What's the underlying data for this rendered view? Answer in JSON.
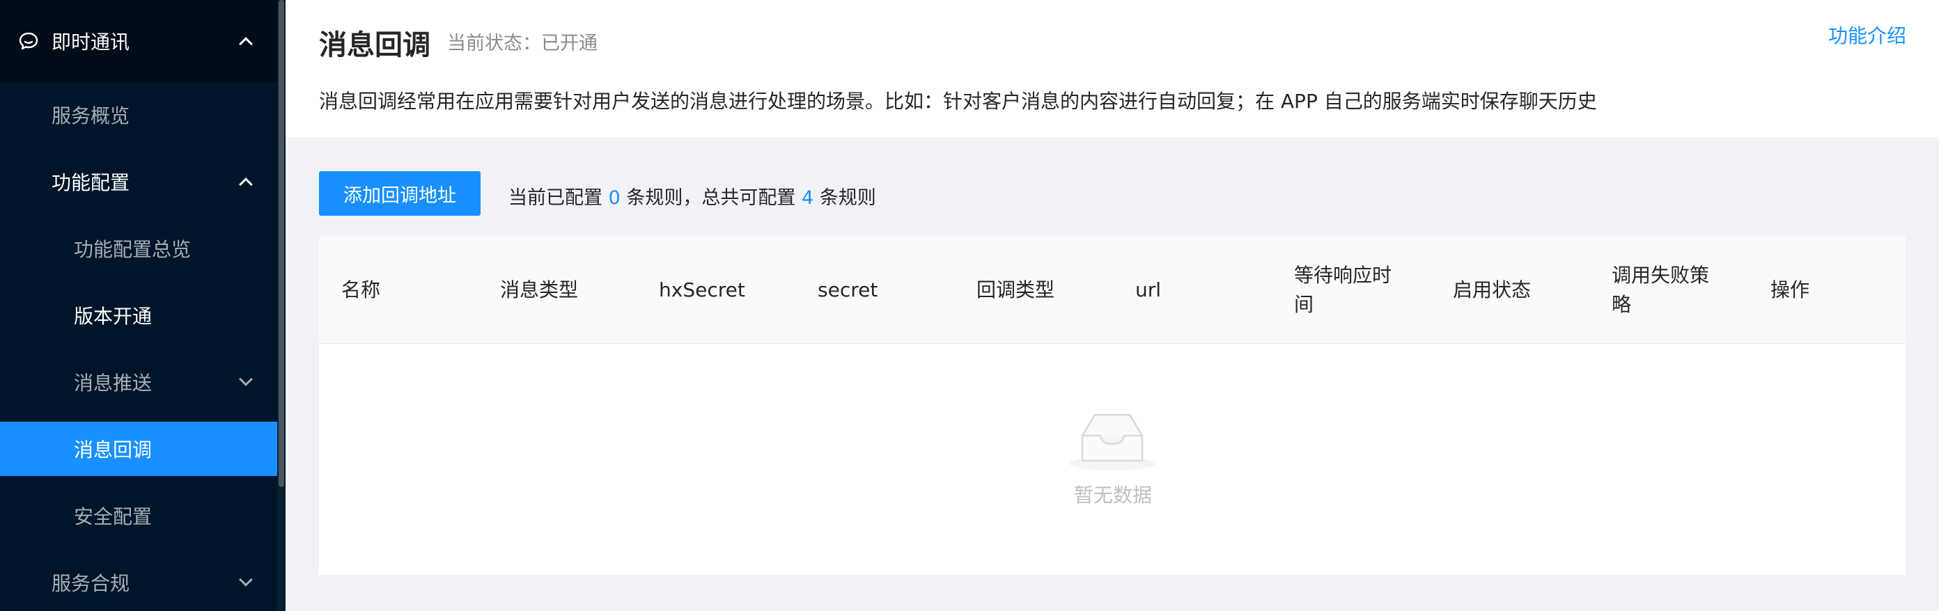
{
  "sidebar": {
    "top": {
      "label": "即时通讯",
      "icon": "chat-icon"
    },
    "items": [
      {
        "label": "服务概览"
      },
      {
        "label": "功能配置"
      },
      {
        "label": "功能配置总览"
      },
      {
        "label": "版本开通"
      },
      {
        "label": "消息推送"
      },
      {
        "label": "消息回调"
      },
      {
        "label": "安全配置"
      },
      {
        "label": "服务合规"
      }
    ]
  },
  "header": {
    "title": "消息回调",
    "status_label": "当前状态：",
    "status_value": "已开通",
    "feature_link": "功能介绍",
    "description": "消息回调经常用在应用需要针对用户发送的消息进行处理的场景。比如：针对客户消息的内容进行自动回复；在 APP 自己的服务端实时保存聊天历史"
  },
  "toolbar": {
    "add_button": "添加回调地址",
    "rule_prefix": "当前已配置",
    "rule_current": "0",
    "rule_middle": "条规则，总共可配置",
    "rule_total": "4",
    "rule_suffix": "条规则"
  },
  "table": {
    "columns": [
      "名称",
      "消息类型",
      "hxSecret",
      "secret",
      "回调类型",
      "url",
      "等待响应时间",
      "启用状态",
      "调用失败策略",
      "操作"
    ],
    "empty_text": "暂无数据"
  },
  "colors": {
    "primary": "#1890ff",
    "sidebar_bg": "#001529",
    "sidebar_top_bg": "#000c17"
  }
}
